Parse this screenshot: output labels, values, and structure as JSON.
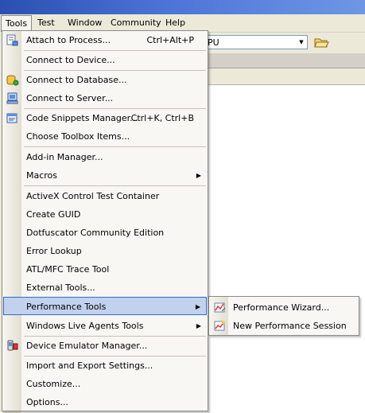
{
  "menubar": {
    "items": [
      "Tools",
      "Test",
      "Window",
      "Community",
      "Help"
    ]
  },
  "toolbar": {
    "config_value": "PU"
  },
  "tools_menu": {
    "items": [
      {
        "label": "Attach to Process...",
        "shortcut": "Ctrl+Alt+P",
        "icon": "attach-process-icon"
      },
      {
        "label": "Connect to Device...",
        "icon": "device-icon"
      },
      {
        "label": "Connect to Database...",
        "icon": "database-icon"
      },
      {
        "label": "Connect to Server...",
        "icon": "server-icon"
      },
      {
        "label": "Code Snippets Manager...",
        "shortcut": "Ctrl+K, Ctrl+B",
        "icon": "snippets-icon"
      },
      {
        "label": "Choose Toolbox Items..."
      },
      {
        "label": "Add-in Manager..."
      },
      {
        "label": "Macros",
        "submenu": true
      },
      {
        "label": "ActiveX Control Test Container"
      },
      {
        "label": "Create GUID"
      },
      {
        "label": "Dotfuscator Community Edition"
      },
      {
        "label": "Error Lookup"
      },
      {
        "label": "ATL/MFC Trace Tool"
      },
      {
        "label": "External Tools..."
      },
      {
        "label": "Performance Tools",
        "submenu": true,
        "highlighted": true
      },
      {
        "label": "Windows Live Agents Tools",
        "submenu": true
      },
      {
        "label": "Device Emulator Manager...",
        "icon": "emulator-icon"
      },
      {
        "label": "Import and Export Settings..."
      },
      {
        "label": "Customize..."
      },
      {
        "label": "Options..."
      }
    ]
  },
  "performance_submenu": {
    "items": [
      {
        "label": "Performance Wizard...",
        "icon": "performance-wizard-icon"
      },
      {
        "label": "New Performance Session",
        "icon": "performance-session-icon"
      }
    ]
  },
  "colors": {
    "highlight_bg": "#c1d2ee",
    "highlight_border": "#316ac5",
    "menu_bg": "#f8f7f3"
  }
}
